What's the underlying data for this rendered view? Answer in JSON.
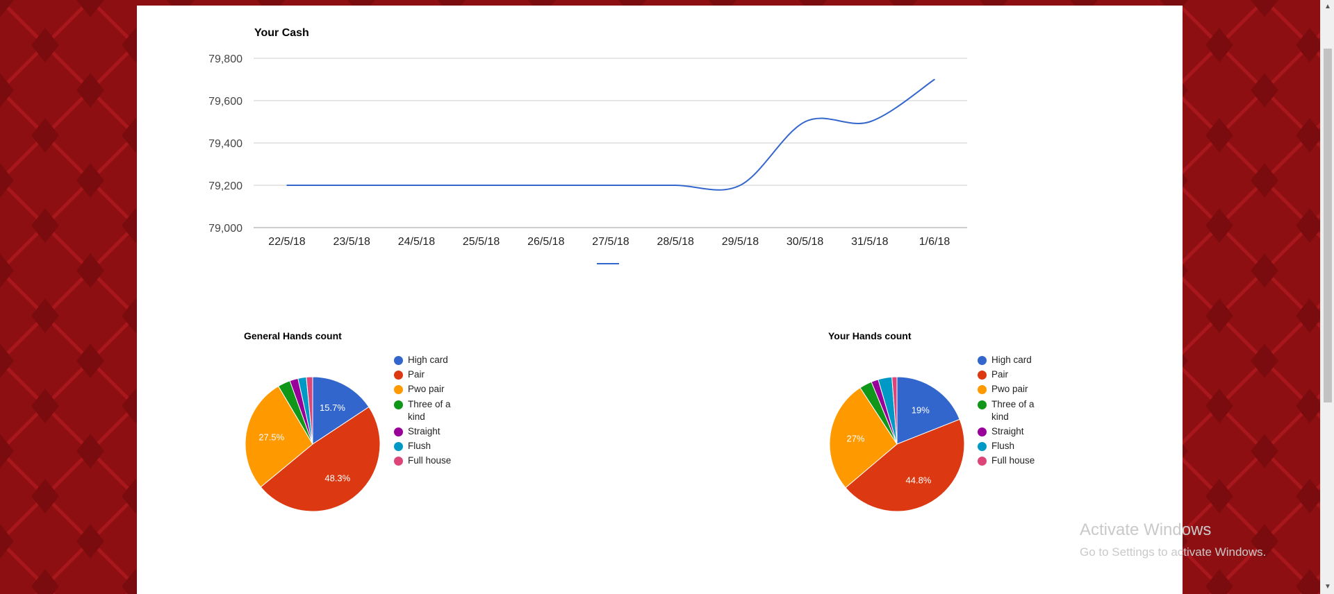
{
  "colors": {
    "background": "#8e0f12",
    "series_line": "#3366cc",
    "slices": [
      "#3366cc",
      "#dc3912",
      "#ff9900",
      "#109618",
      "#990099",
      "#0099c6",
      "#dd4477"
    ]
  },
  "chart_data": [
    {
      "type": "line",
      "title": "Your Cash",
      "x": [
        "22/5/18",
        "23/5/18",
        "24/5/18",
        "25/5/18",
        "26/5/18",
        "27/5/18",
        "28/5/18",
        "29/5/18",
        "30/5/18",
        "31/5/18",
        "1/6/18"
      ],
      "series": [
        {
          "values": [
            79200,
            79200,
            79200,
            79200,
            79200,
            79200,
            79200,
            79200,
            79500,
            79500,
            79700
          ]
        }
      ],
      "ylim": [
        79000,
        79800
      ],
      "yticks": [
        "79,000",
        "79,200",
        "79,400",
        "79,600",
        "79,800"
      ],
      "grid": true,
      "legend": "bottom"
    },
    {
      "type": "pie",
      "title": "General Hands count",
      "labels": [
        "High card",
        "Pair",
        "Pwo pair",
        "Three of a kind",
        "Straight",
        "Flush",
        "Full house"
      ],
      "values": [
        15.7,
        48.3,
        27.5,
        3.0,
        2.0,
        2.0,
        1.5
      ],
      "slice_labels": [
        "15.7%",
        "48.3%",
        "27.5%",
        "",
        "",
        "",
        ""
      ],
      "legend": "right"
    },
    {
      "type": "pie",
      "title": "Your Hands count",
      "labels": [
        "High card",
        "Pair",
        "Pwo pair",
        "Three of a kind",
        "Straight",
        "Flush",
        "Full house"
      ],
      "values": [
        19.0,
        44.8,
        27.0,
        3.0,
        1.7,
        3.3,
        1.2
      ],
      "slice_labels": [
        "19%",
        "44.8%",
        "27%",
        "",
        "",
        "",
        ""
      ],
      "legend": "right"
    }
  ],
  "watermark": {
    "title": "Activate Windows",
    "subtitle": "Go to Settings to activate Windows."
  }
}
